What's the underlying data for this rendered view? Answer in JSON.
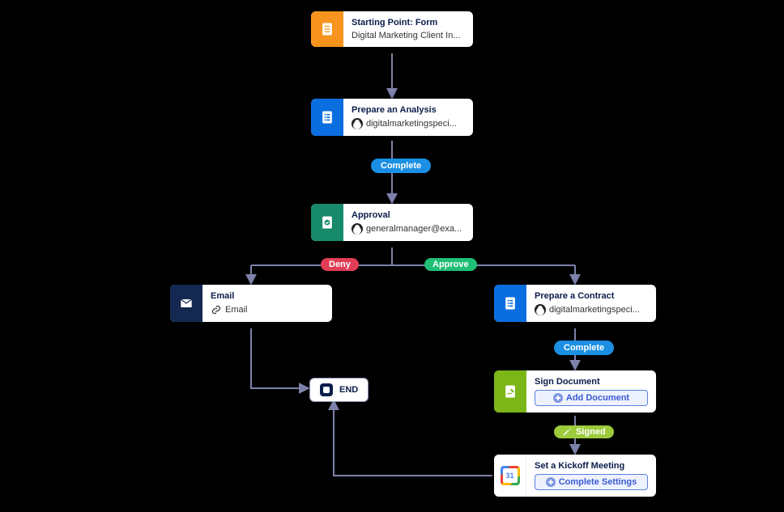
{
  "colors": {
    "orange": "#f7941d",
    "blue": "#0b6ee0",
    "teal": "#178a6b",
    "navy": "#142850",
    "green": "#7cb518",
    "white": "#ffffff",
    "pill_blue": "#1a8fe3",
    "pill_red": "#e13d55",
    "pill_green": "#1fbf75",
    "pill_lime": "#9ccc3c",
    "connector": "#7d82aa"
  },
  "nodes": {
    "start": {
      "title": "Starting Point: Form",
      "subtitle": "Digital Marketing Client In..."
    },
    "analysis": {
      "title": "Prepare an Analysis",
      "assignee": "digitalmarketingspeci..."
    },
    "approval": {
      "title": "Approval",
      "assignee": "generalmanager@exa..."
    },
    "email": {
      "title": "Email",
      "subtitle": "Email"
    },
    "contract": {
      "title": "Prepare a Contract",
      "assignee": "digitalmarketingspeci..."
    },
    "sign": {
      "title": "Sign Document",
      "action": "Add Document"
    },
    "kickoff": {
      "title": "Set a Kickoff Meeting",
      "action": "Complete Settings"
    },
    "end": {
      "label": "END"
    }
  },
  "edges": {
    "complete1": "Complete",
    "deny": "Deny",
    "approve": "Approve",
    "complete2": "Complete",
    "signed": "Signed"
  }
}
